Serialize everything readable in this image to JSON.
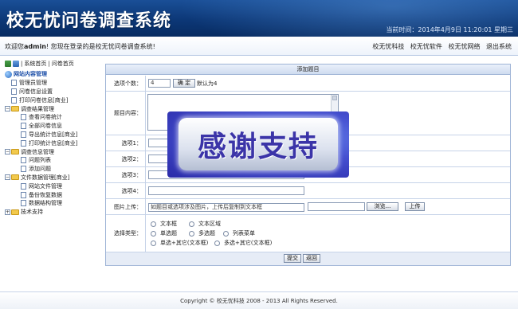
{
  "header": {
    "title": "校无忧问卷调查系统",
    "clock": "当前时间：2014年4月9日  11:20:01 星期三"
  },
  "userbar": {
    "welcome_prefix": "欢迎您",
    "username": "admin",
    "welcome_suffix": "! 您现在登录的是校无忧问卷调查系统!",
    "links": [
      "校无忧科技",
      "校无忧软件",
      "校无忧网络",
      "退出系统"
    ]
  },
  "sidebar": {
    "top_links": [
      "系统首页",
      "问卷首页"
    ],
    "tree": [
      {
        "label": "网站内容管理",
        "level": 0,
        "kind": "home"
      },
      {
        "label": "管理员管理",
        "level": 1,
        "kind": "leaf"
      },
      {
        "label": "问卷信息设置",
        "level": 1,
        "kind": "leaf"
      },
      {
        "label": "打印问卷信息[商业]",
        "level": 1,
        "kind": "leaf"
      },
      {
        "label": "调查结果管理",
        "level": 1,
        "kind": "folder"
      },
      {
        "label": "查看问卷统计",
        "level": 2,
        "kind": "leaf"
      },
      {
        "label": "全部问卷信息",
        "level": 2,
        "kind": "leaf"
      },
      {
        "label": "导出统计信息[商业]",
        "level": 2,
        "kind": "leaf"
      },
      {
        "label": "打印统计信息[商业]",
        "level": 2,
        "kind": "leaf"
      },
      {
        "label": "调查信息管理",
        "level": 1,
        "kind": "folder"
      },
      {
        "label": "问题列表",
        "level": 2,
        "kind": "leaf"
      },
      {
        "label": "添加问题",
        "level": 2,
        "kind": "leaf"
      },
      {
        "label": "文件数据管理[商业]",
        "level": 1,
        "kind": "folder"
      },
      {
        "label": "网站文件管理",
        "level": 2,
        "kind": "leaf"
      },
      {
        "label": "备份恢复数据",
        "level": 2,
        "kind": "leaf"
      },
      {
        "label": "数据结构管理",
        "level": 2,
        "kind": "leaf"
      },
      {
        "label": "技术支持",
        "level": 1,
        "kind": "folder"
      }
    ]
  },
  "form": {
    "heading": "添加题目",
    "option_count_label": "选项个数：",
    "option_count_value": "4",
    "confirm_button": "确 定",
    "default_hint": "默认为4",
    "content_label": "题目内容：",
    "option1_label": "选项1：",
    "option2_label": "选项2：",
    "option3_label": "选项3：",
    "option4_label": "选项4：",
    "image_label": "图片上传：",
    "image_hint": "如题目或选项涉及图片，上传后复制到文本框",
    "browse_button": "浏览...",
    "upload_button": "上传",
    "type_label": "选择类型：",
    "types": [
      "文本框",
      "文本区域",
      "单选题",
      "多选题",
      "列表菜单",
      "单选+其它(文本框)",
      "多选+其它(文本框)"
    ],
    "submit_button": "提交",
    "back_button": "返回"
  },
  "overlay": {
    "text": "感谢支持"
  },
  "footer": {
    "copyright": "Copyright © 校无忧科技  2008 - 2013 All Rights Reserved."
  }
}
